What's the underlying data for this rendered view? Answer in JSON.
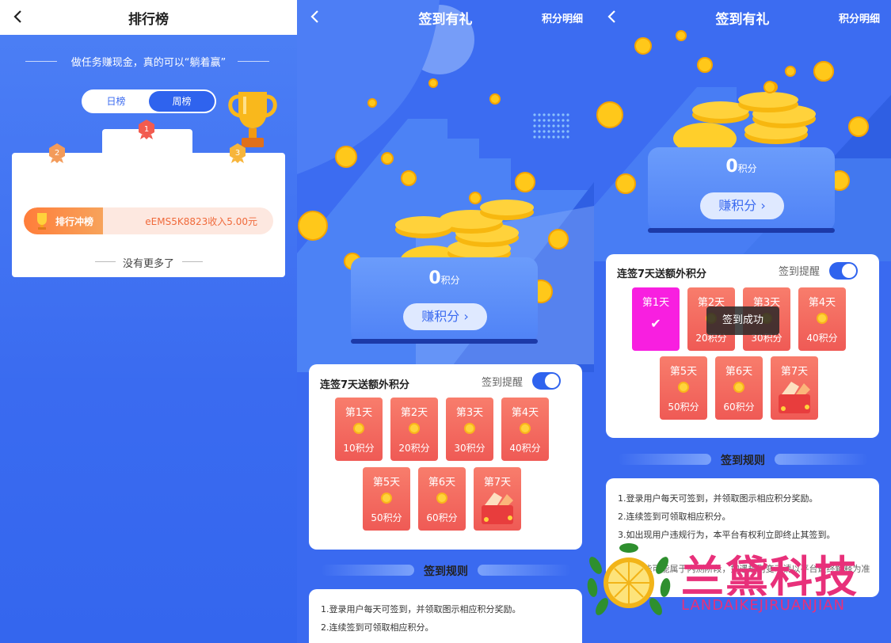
{
  "leaderboard": {
    "title": "排行榜",
    "slogan": "做任务赚现金，真的可以“躺着赢”",
    "tabs": [
      {
        "label": "日榜",
        "active": false
      },
      {
        "label": "周榜",
        "active": true
      }
    ],
    "ranks": [
      "1",
      "2",
      "3"
    ],
    "rank_label": "排行冲榜",
    "rank_text": "eEMS5K8823收入5.00元",
    "no_more": "没有更多了"
  },
  "signin": {
    "title": "签到有礼",
    "detail_link": "积分明细",
    "score": "0",
    "score_unit": "积分",
    "earn_button": "赚积分",
    "streak_title": "连签7天送额外积分",
    "remind_label": "签到提醒",
    "remind_on": true,
    "days": [
      {
        "label": "第1天",
        "points": "10积分"
      },
      {
        "label": "第2天",
        "points": "20积分"
      },
      {
        "label": "第3天",
        "points": "30积分"
      },
      {
        "label": "第4天",
        "points": "40积分"
      },
      {
        "label": "第5天",
        "points": "50积分"
      },
      {
        "label": "第6天",
        "points": "60积分"
      },
      {
        "label": "第7天",
        "points": ""
      }
    ],
    "rules_title": "签到规则",
    "rules": [
      "1.登录用户每天可签到，并领取图示相应积分奖励。",
      "2.连续签到可领取相应积分。",
      "3.如出现用户违规行为，本平台有权利立即终止其签到。"
    ],
    "rules_partial": "4.此功能可能属于内测阶段，如遇规则变动请以平台最终解释为准",
    "toast": "签到成功"
  },
  "watermark": {
    "text": "兰黛科技",
    "sub": "LANDAIKEJIRUANJIAN"
  },
  "colors": {
    "primary": "#3a6af0",
    "day_card": "#ef5a55",
    "checked_day": "#f81fe0",
    "accent": "#ff7d3a"
  }
}
